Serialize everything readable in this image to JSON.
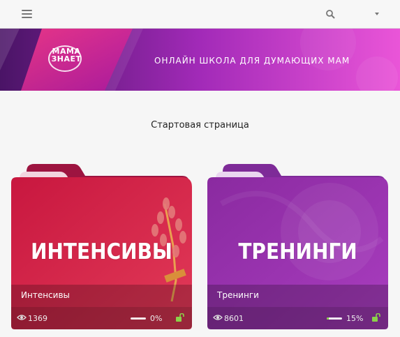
{
  "header": {
    "menu_icon": "hamburger-icon",
    "search_icon": "search-icon",
    "dropdown_icon": "caret-down-icon"
  },
  "banner": {
    "logo_line1": "МАМА",
    "logo_line2": "ЗНАЕТ",
    "tagline": "ОНЛАЙН ШКОЛА ДЛЯ ДУМАЮЩИХ МАМ"
  },
  "page": {
    "title": "Стартовая страница"
  },
  "cards": [
    {
      "cover_text": "ИНТЕНСИВЫ",
      "label": "Интенсивы",
      "views": "1369",
      "progress_text": "0%",
      "progress": 0,
      "colors": {
        "main": "#d8254a",
        "accent": "#b2173d"
      },
      "icons": [
        "eye-icon",
        "unlock-icon"
      ]
    },
    {
      "cover_text": "ТРЕНИНГИ",
      "label": "Тренинги",
      "views": "8601",
      "progress_text": "15%",
      "progress": 15,
      "colors": {
        "main": "#9b2fa8",
        "accent": "#7a239a"
      },
      "icons": [
        "eye-icon",
        "unlock-icon"
      ]
    }
  ],
  "colors": {
    "banner_left": "#6a1b8a",
    "banner_right": "#e64bd3",
    "progress_fill": "#8bd14a",
    "lock_green": "#8bd14a"
  }
}
